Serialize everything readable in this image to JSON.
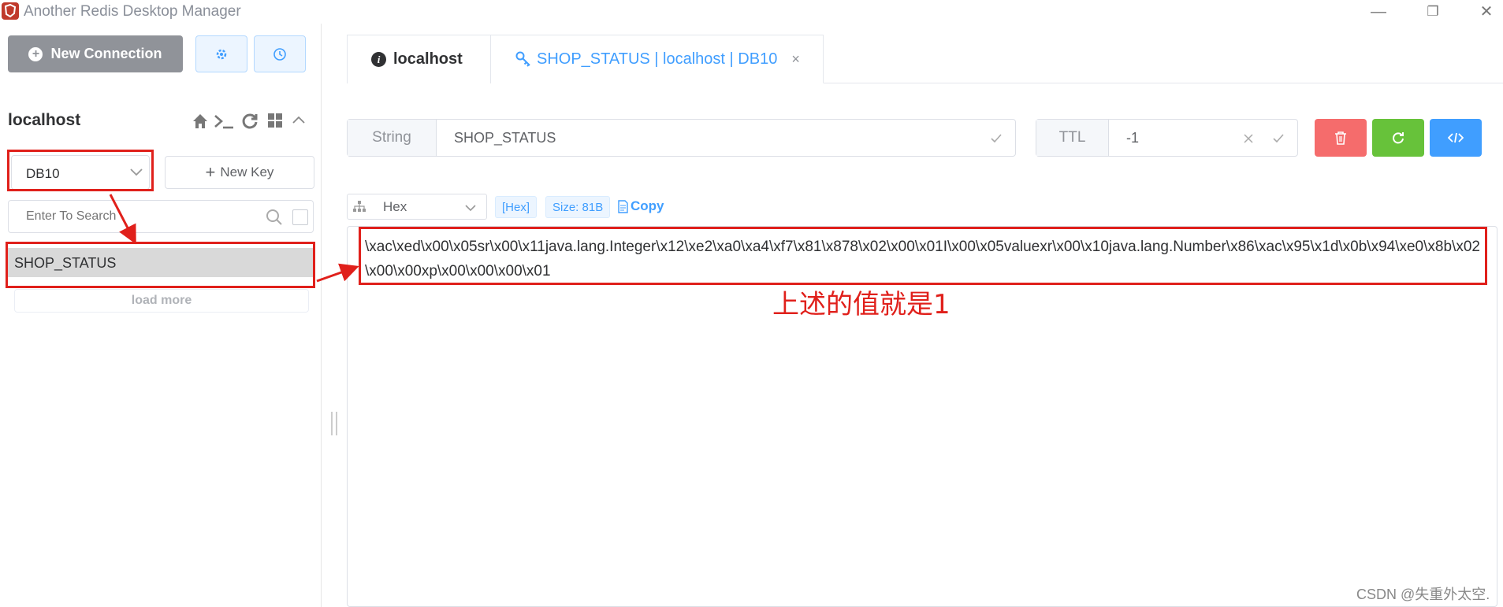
{
  "window": {
    "title": "Another Redis Desktop Manager",
    "controls": [
      "—",
      "❐",
      "✕"
    ]
  },
  "sidebar": {
    "new_connection_label": "New Connection",
    "connection_name": "localhost",
    "db_selected": "DB10",
    "new_key_label": "New Key",
    "search_placeholder": "Enter To Search",
    "keys": [
      "SHOP_STATUS"
    ],
    "load_more_label": "load more"
  },
  "tabs": [
    {
      "label": "localhost"
    },
    {
      "label": "SHOP_STATUS | localhost | DB10",
      "close": "×"
    }
  ],
  "key_editor": {
    "type_label": "String",
    "key_name": "SHOP_STATUS",
    "ttl_label": "TTL",
    "ttl_value": "-1"
  },
  "viewer": {
    "format": "Hex",
    "format_tag": "[Hex]",
    "size_tag": "Size: 81B",
    "copy_label": "Copy",
    "value": "\\xac\\xed\\x00\\x05sr\\x00\\x11java.lang.Integer\\x12\\xe2\\xa0\\xa4\\xf7\\x81\\x878\\x02\\x00\\x01I\\x00\\x05valuexr\\x00\\x10java.lang.Number\\x86\\xac\\x95\\x1d\\x0b\\x94\\xe0\\x8b\\x02\\x00\\x00xp\\x00\\x00\\x00\\x01"
  },
  "annotation": {
    "text": "上述的值就是1",
    "color": "#e0201b"
  },
  "watermark": "CSDN @失重外太空.",
  "colors": {
    "primary": "#409eff",
    "danger": "#f56c6c",
    "success": "#67c23a",
    "info": "#909399"
  }
}
